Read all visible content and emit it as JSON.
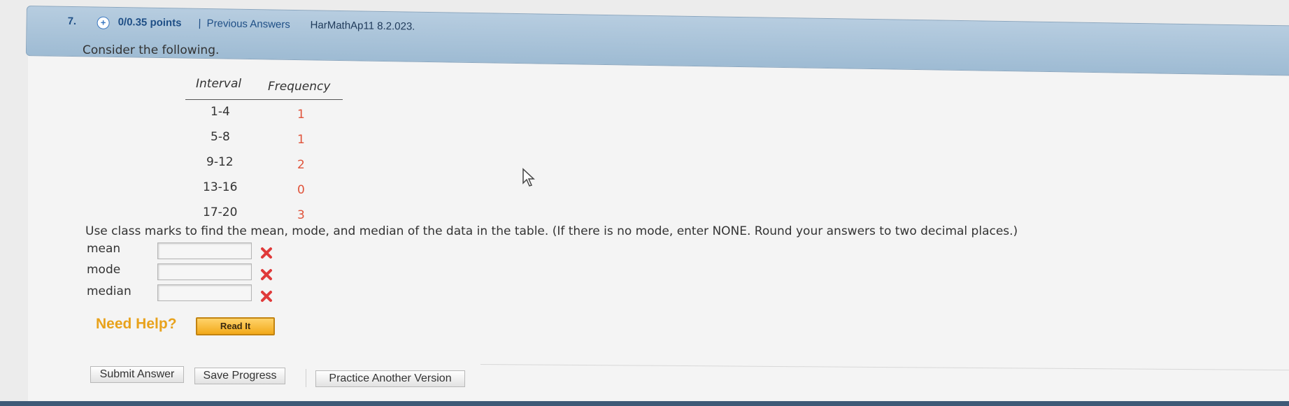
{
  "header": {
    "question_number": "7.",
    "plus_icon": "+",
    "points": "0/0.35 points",
    "separator": "|",
    "previous_answers": "Previous Answers",
    "assignment_code": "HarMathAp11 8.2.023."
  },
  "question": {
    "prompt": "Consider the following.",
    "table": {
      "headers": [
        "Interval",
        "Frequency"
      ],
      "rows": [
        {
          "interval": "1-4",
          "frequency": "1"
        },
        {
          "interval": "5-8",
          "frequency": "1"
        },
        {
          "interval": "9-12",
          "frequency": "2"
        },
        {
          "interval": "13-16",
          "frequency": "0"
        },
        {
          "interval": "17-20",
          "frequency": "3"
        }
      ]
    },
    "instructions": "Use class marks to find the mean, mode, and median of the data in the table. (If there is no mode, enter NONE. Round your answers to two decimal places.)",
    "answers": [
      {
        "label": "mean",
        "value": "",
        "status": "incorrect",
        "icon": "x-icon"
      },
      {
        "label": "mode",
        "value": "",
        "status": "incorrect",
        "icon": "x-icon"
      },
      {
        "label": "median",
        "value": "",
        "status": "incorrect",
        "icon": "x-icon"
      }
    ]
  },
  "help": {
    "need_help": "Need Help?",
    "read_it": "Read It"
  },
  "actions": {
    "submit": "Submit Answer",
    "save": "Save Progress",
    "practice": "Practice Another Version"
  },
  "colors": {
    "header_bar": "#a9c4da",
    "link": "#1f4f86",
    "frequency": "#e0533a",
    "error_x": "#e03a3a",
    "need_help": "#e8a21c",
    "read_it": "#f2a919"
  }
}
